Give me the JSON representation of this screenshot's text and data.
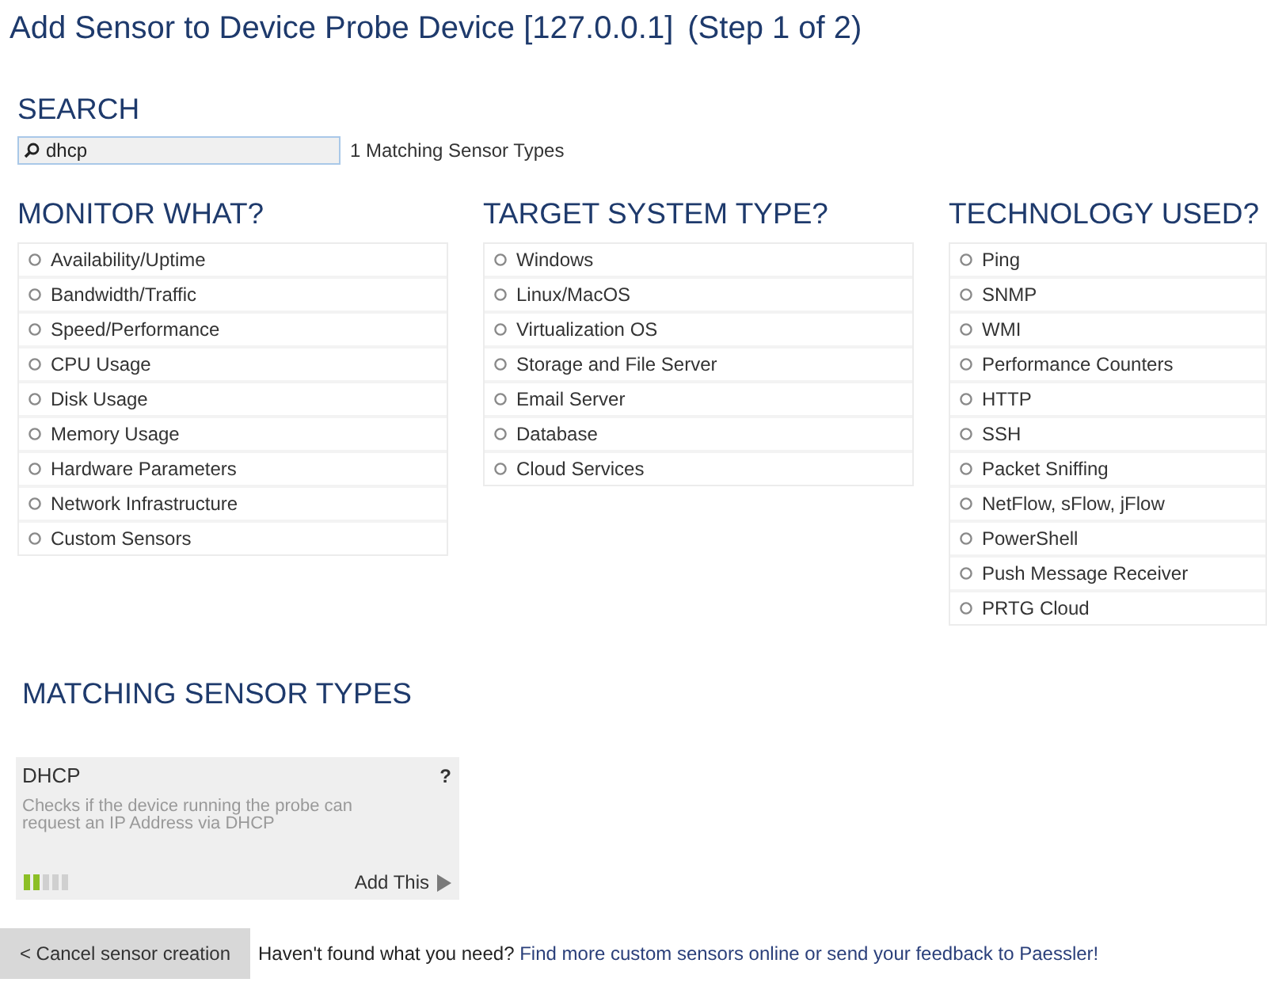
{
  "page": {
    "title": "Add Sensor to Device Probe Device [127.0.0.1]",
    "step": "(Step 1 of 2)"
  },
  "search": {
    "heading": "SEARCH",
    "value": "dhcp",
    "result_count": "1 Matching Sensor Types"
  },
  "filters": [
    {
      "heading": "MONITOR WHAT?",
      "options": [
        {
          "label": "Availability/Uptime",
          "selected": false
        },
        {
          "label": "Bandwidth/Traffic",
          "selected": false
        },
        {
          "label": "Speed/Performance",
          "selected": false
        },
        {
          "label": "CPU Usage",
          "selected": false
        },
        {
          "label": "Disk Usage",
          "selected": false
        },
        {
          "label": "Memory Usage",
          "selected": false
        },
        {
          "label": "Hardware Parameters",
          "selected": false
        },
        {
          "label": "Network Infrastructure",
          "selected": false
        },
        {
          "label": "Custom Sensors",
          "selected": false
        }
      ]
    },
    {
      "heading": "TARGET SYSTEM TYPE?",
      "options": [
        {
          "label": "Windows",
          "selected": false
        },
        {
          "label": "Linux/MacOS",
          "selected": false
        },
        {
          "label": "Virtualization OS",
          "selected": false
        },
        {
          "label": "Storage and File Server",
          "selected": false
        },
        {
          "label": "Email Server",
          "selected": false
        },
        {
          "label": "Database",
          "selected": false
        },
        {
          "label": "Cloud Services",
          "selected": false
        }
      ]
    },
    {
      "heading": "TECHNOLOGY USED?",
      "options": [
        {
          "label": "Ping",
          "selected": false
        },
        {
          "label": "SNMP",
          "selected": false
        },
        {
          "label": "WMI",
          "selected": false
        },
        {
          "label": "Performance Counters",
          "selected": false
        },
        {
          "label": "HTTP",
          "selected": false
        },
        {
          "label": "SSH",
          "selected": false
        },
        {
          "label": "Packet Sniffing",
          "selected": false
        },
        {
          "label": "NetFlow, sFlow, jFlow",
          "selected": false
        },
        {
          "label": "PowerShell",
          "selected": false
        },
        {
          "label": "Push Message Receiver",
          "selected": false
        },
        {
          "label": "PRTG Cloud",
          "selected": false
        }
      ]
    }
  ],
  "matching": {
    "heading": "MATCHING SENSOR TYPES",
    "sensors": [
      {
        "name": "DHCP",
        "help": "?",
        "description": "Checks if the device running the probe can request an IP Address via DHCP",
        "level": 0.4,
        "action": "Add This"
      }
    ]
  },
  "footer": {
    "cancel_button": "< Cancel sensor creation",
    "prompt": "Haven't found what you need?",
    "link": "Find more custom sensors online or send your feedback to Paessler!"
  }
}
